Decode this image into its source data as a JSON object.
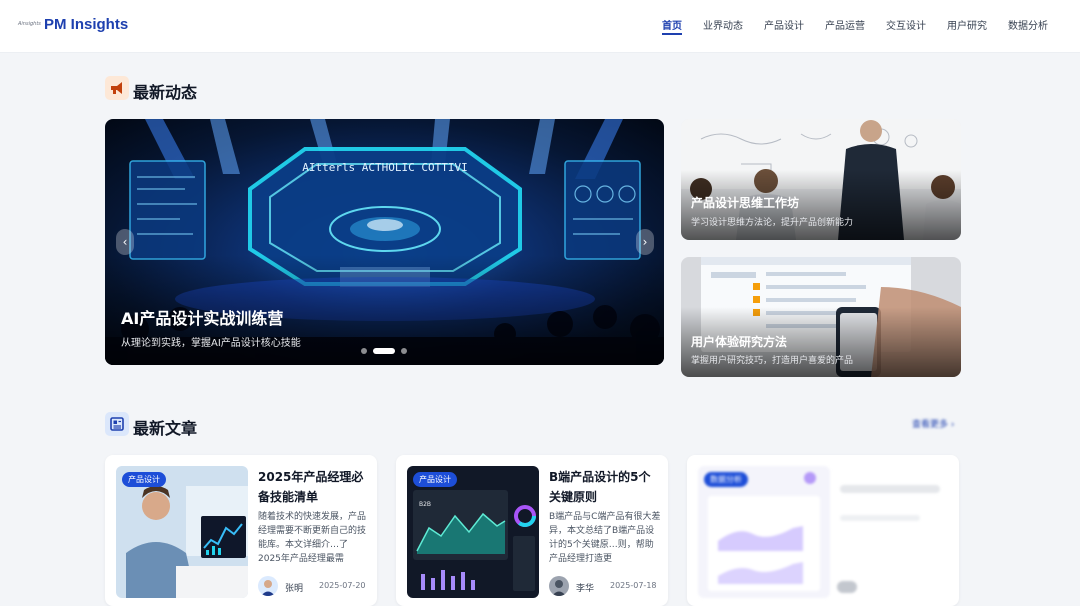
{
  "header": {
    "logo_mark": "Ainsights",
    "logo_text": "PM Insights",
    "nav": [
      {
        "label": "首页",
        "active": true
      },
      {
        "label": "业界动态",
        "active": false
      },
      {
        "label": "产品设计",
        "active": false
      },
      {
        "label": "产品运营",
        "active": false
      },
      {
        "label": "交互设计",
        "active": false
      },
      {
        "label": "用户研究",
        "active": false
      },
      {
        "label": "数据分析",
        "active": false
      }
    ]
  },
  "news": {
    "title": "最新动态",
    "icon": "megaphone-icon",
    "hero": {
      "screen_text": "AItterls ACTHOLIC COTTIVI",
      "title": "AI产品设计实战训练营",
      "subtitle": "从理论到实践，掌握AI产品设计核心技能",
      "slide_count": 3,
      "active_slide": 2
    },
    "side_cards": [
      {
        "title": "产品设计思维工作坊",
        "subtitle": "学习设计思维方法论，提升产品创新能力"
      },
      {
        "title": "用户体验研究方法",
        "subtitle": "掌握用户研究技巧，打造用户喜爱的产品"
      }
    ]
  },
  "articles": {
    "title": "最新文章",
    "icon": "newspaper-icon",
    "view_all": "查看更多 ›",
    "items": [
      {
        "tag": "产品设计",
        "title": "2025年产品经理必备技能清单",
        "excerpt": "随着技术的快速发展，产品经理需要不断更新自己的技能库。本文详细介…了2025年产品经理最需",
        "author": "张明",
        "date": "2025-07-20"
      },
      {
        "tag": "产品设计",
        "title": "B端产品设计的5个关键原则",
        "excerpt": "B端产品与C端产品有很大差异，本文总结了B端产品设计的5个关键原…则，帮助产品经理打造更",
        "author": "李华",
        "date": "2025-07-18",
        "thumb_label": "B2B"
      },
      {
        "tag": "数据分析",
        "title": "",
        "excerpt": "",
        "author": "",
        "date": ""
      }
    ]
  },
  "colors": {
    "brand": "#1e40af",
    "tag": "#1d4ed8",
    "background": "#f3f5f8",
    "megaphone_bg": "#fde8d7",
    "newspaper_bg": "#dbe7fb"
  }
}
